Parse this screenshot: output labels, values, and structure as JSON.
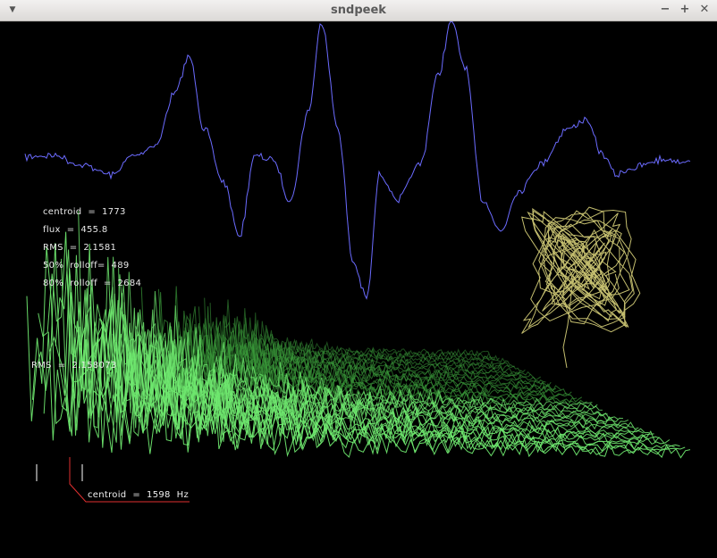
{
  "window": {
    "title": "sndpeek",
    "menu_icon": "triangle-down-icon",
    "minimize_icon": "minimize-icon",
    "maximize_icon": "maximize-icon",
    "close_icon": "close-icon",
    "minimize_glyph": "−",
    "maximize_glyph": "+",
    "close_glyph": "✕",
    "menu_glyph": "▼"
  },
  "features": {
    "centroid": "centroid  =  1773",
    "flux": "flux  =  455.8",
    "rms": "RMS  =  2.1581",
    "rolloff50": "50%  rolloff=  489",
    "rolloff80": "80%  rolloff  =  2684"
  },
  "rms_readout": "RMS  =  2.158073",
  "centroid_marker": "centroid  =  1598  Hz",
  "colors": {
    "background": "#000000",
    "waveform": "#6b6bff",
    "spectrum_front": "#6fe86f",
    "spectrum_back": "#3a9a3a",
    "lissajous": "#d8d27a",
    "centroid_line": "#e03030",
    "text": "#e8e8e8"
  }
}
